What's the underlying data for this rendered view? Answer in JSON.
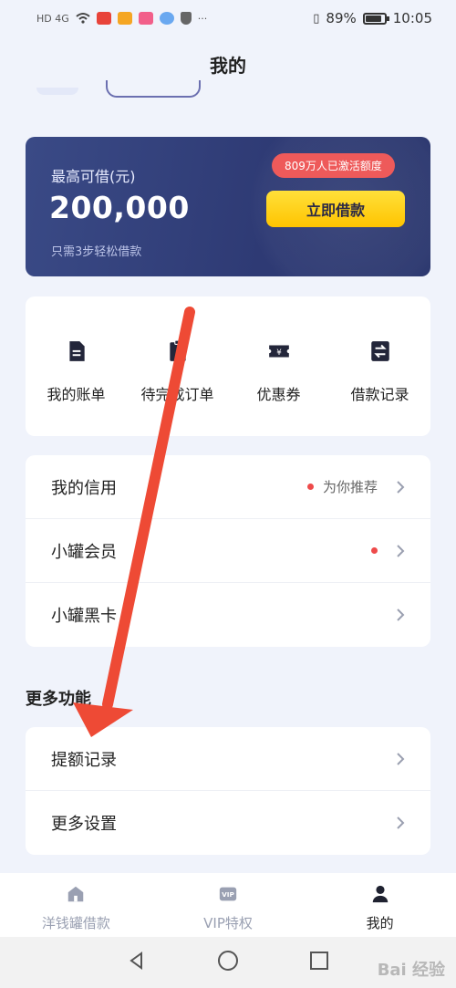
{
  "status_bar": {
    "network": "HD 4G",
    "battery": "89%",
    "time": "10:05",
    "more": "···"
  },
  "page": {
    "title": "我的"
  },
  "credit_card": {
    "label": "最高可借(元)",
    "amount": "200,000",
    "hint": "只需3步轻松借款",
    "badge": "809万人已激活额度",
    "borrow_button": "立即借款"
  },
  "quick_actions": [
    {
      "label": "我的账单",
      "icon": "bill-icon"
    },
    {
      "label": "待完成订单",
      "icon": "clipboard-icon"
    },
    {
      "label": "优惠券",
      "icon": "coupon-icon"
    },
    {
      "label": "借款记录",
      "icon": "transfer-icon"
    }
  ],
  "menu_primary": [
    {
      "label": "我的信用",
      "hint": "为你推荐",
      "dot": true
    },
    {
      "label": "小罐会员",
      "hint": "",
      "dot": true
    },
    {
      "label": "小罐黑卡",
      "hint": "",
      "dot": false
    }
  ],
  "more_section": {
    "heading": "更多功能",
    "items": [
      {
        "label": "提额记录"
      },
      {
        "label": "更多设置"
      }
    ]
  },
  "tab_bar": [
    {
      "label": "洋钱罐借款",
      "icon": "home-icon",
      "active": false
    },
    {
      "label": "VIP特权",
      "icon": "vip-icon",
      "active": false
    },
    {
      "label": "我的",
      "icon": "user-icon",
      "active": true
    }
  ],
  "watermark": "Bai 经验",
  "colors": {
    "card_bg": "#2e3a74",
    "borrow_button": "#ffd21a",
    "badge": "#ee5a5a",
    "annotation_arrow": "#ee4a35",
    "page_bg": "#f0f3fb"
  }
}
